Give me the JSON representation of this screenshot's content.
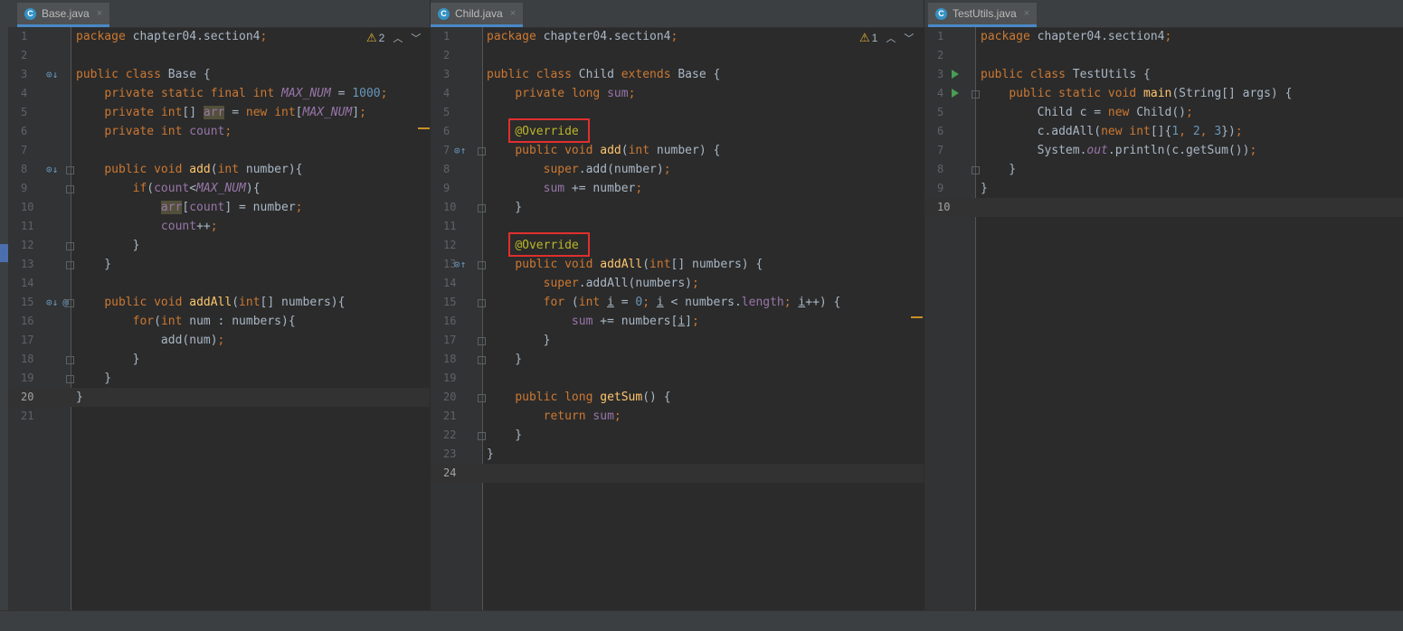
{
  "tabs": {
    "base": {
      "label": "Base.java",
      "close": "×",
      "icon": "C"
    },
    "child": {
      "label": "Child.java",
      "close": "×",
      "icon": "C"
    },
    "testutils": {
      "label": "TestUtils.java",
      "close": "×",
      "icon": "C"
    }
  },
  "inspections": {
    "base": {
      "count": "2"
    },
    "child": {
      "count": "1"
    }
  },
  "colors": {
    "keyword": "#cc7832",
    "method": "#ffc66d",
    "field": "#9876aa",
    "number": "#6897bb",
    "annotation": "#bbb529",
    "highlight_box": "#e0302e"
  },
  "editors": {
    "base": {
      "line_numbers": [
        "1",
        "2",
        "3",
        "4",
        "5",
        "6",
        "7",
        "8",
        "9",
        "10",
        "11",
        "12",
        "13",
        "14",
        "15",
        "16",
        "17",
        "18",
        "19",
        "20",
        "21"
      ],
      "current_line": "20",
      "lines": [
        "package chapter04.section4;",
        "",
        "public class Base {",
        "    private static final int MAX_NUM = 1000;",
        "    private int[] arr = new int[MAX_NUM];",
        "    private int count;",
        "",
        "    public void add(int number){",
        "        if(count<MAX_NUM){",
        "            arr[count] = number;",
        "            count++;",
        "        }",
        "    }",
        "",
        "    public void addAll(int[] numbers){",
        "        for(int num : numbers){",
        "            add(num);",
        "        }",
        "    }",
        "}",
        ""
      ]
    },
    "child": {
      "line_numbers": [
        "1",
        "2",
        "3",
        "4",
        "5",
        "6",
        "7",
        "8",
        "9",
        "10",
        "11",
        "12",
        "13",
        "14",
        "15",
        "16",
        "17",
        "18",
        "19",
        "20",
        "21",
        "22",
        "23",
        "24"
      ],
      "current_line": "24",
      "lines": [
        "package chapter04.section4;",
        "",
        "public class Child extends Base {",
        "    private long sum;",
        "",
        "    @Override",
        "    public void add(int number) {",
        "        super.add(number);",
        "        sum += number;",
        "    }",
        "",
        "    @Override",
        "    public void addAll(int[] numbers) {",
        "        super.addAll(numbers);",
        "        for (int i = 0; i < numbers.length; i++) {",
        "            sum += numbers[i];",
        "        }",
        "    }",
        "",
        "    public long getSum() {",
        "        return sum;",
        "    }",
        "}",
        ""
      ]
    },
    "testutils": {
      "line_numbers": [
        "1",
        "2",
        "3",
        "4",
        "5",
        "6",
        "7",
        "8",
        "9",
        "10"
      ],
      "current_line": "10",
      "lines": [
        "package chapter04.section4;",
        "",
        "public class TestUtils {",
        "    public static void main(String[] args) {",
        "        Child c = new Child();",
        "        c.addAll(new int[]{1, 2, 3});",
        "        System.out.println(c.getSum());",
        "    }",
        "}",
        ""
      ]
    }
  }
}
